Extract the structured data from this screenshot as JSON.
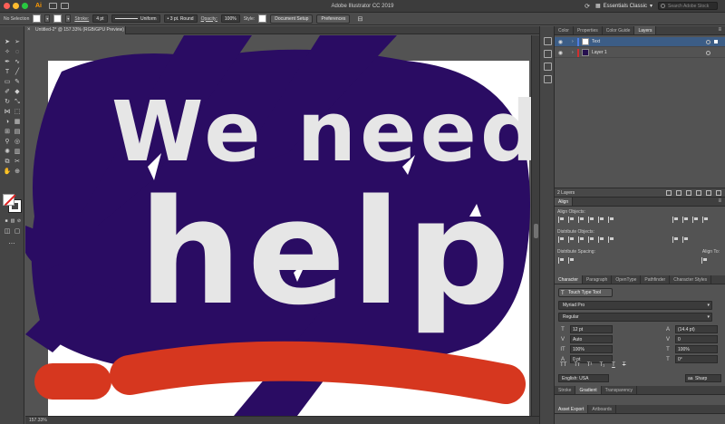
{
  "window": {
    "title": "Adobe Illustrator CC 2019",
    "app_logo": "Ai",
    "workspace": "Essentials Classic",
    "search_placeholder": "Search Adobe Stock"
  },
  "control_bar": {
    "selection_label": "No Selection",
    "stroke_label": "Stroke:",
    "stroke_value": "4 pt",
    "profile_label": "Uniform",
    "brush_label": "3 pt. Round",
    "opacity_label": "Opacity:",
    "opacity_value": "100%",
    "style_label": "Style:",
    "document_setup": "Document Setup",
    "preferences": "Preferences"
  },
  "document": {
    "tab_title": "Untitled-2* @ 157.33% (RGB/GPU Preview)",
    "zoom": "157.33%",
    "artwork": {
      "line1": "We need",
      "line2": "help!",
      "background_color": "#2a0c63",
      "text_color": "#e6e6e6",
      "underline_color": "#d6371f",
      "artboard_color": "#ffffff"
    }
  },
  "panels": {
    "top_tabs": [
      "Color",
      "Properties",
      "Color Guide",
      "Layers"
    ],
    "top_active": "Layers",
    "layers": [
      {
        "name": "Text",
        "color": "#4f7de0",
        "selected": true
      },
      {
        "name": "Layer 1",
        "color": "#d12f2f",
        "selected": false
      }
    ],
    "layers_count": "2 Layers",
    "align": {
      "title": "Align",
      "align_objects": "Align Objects:",
      "distribute_objects": "Distribute Objects:",
      "distribute_spacing": "Distribute Spacing:",
      "align_to": "Align To:"
    },
    "character": {
      "tabs": [
        "Character",
        "Paragraph",
        "OpenType",
        "Pathfinder",
        "Character Styles"
      ],
      "touch_type": "Touch Type Tool",
      "font_family": "Myriad Pro",
      "font_style": "Regular",
      "font_size": "12 pt",
      "leading": "(14.4 pt)",
      "kerning": "Auto",
      "tracking": "0",
      "vertical_scale": "100%",
      "horizontal_scale": "100%",
      "baseline_shift": "0 pt",
      "rotation": "0°",
      "language": "English: USA",
      "anti_alias": "Sharp"
    },
    "bottom_tabs": [
      "Stroke",
      "Gradient",
      "Transparency"
    ],
    "bottom_active": "Gradient",
    "footer_tabs": [
      "Asset Export",
      "Artboards"
    ]
  }
}
